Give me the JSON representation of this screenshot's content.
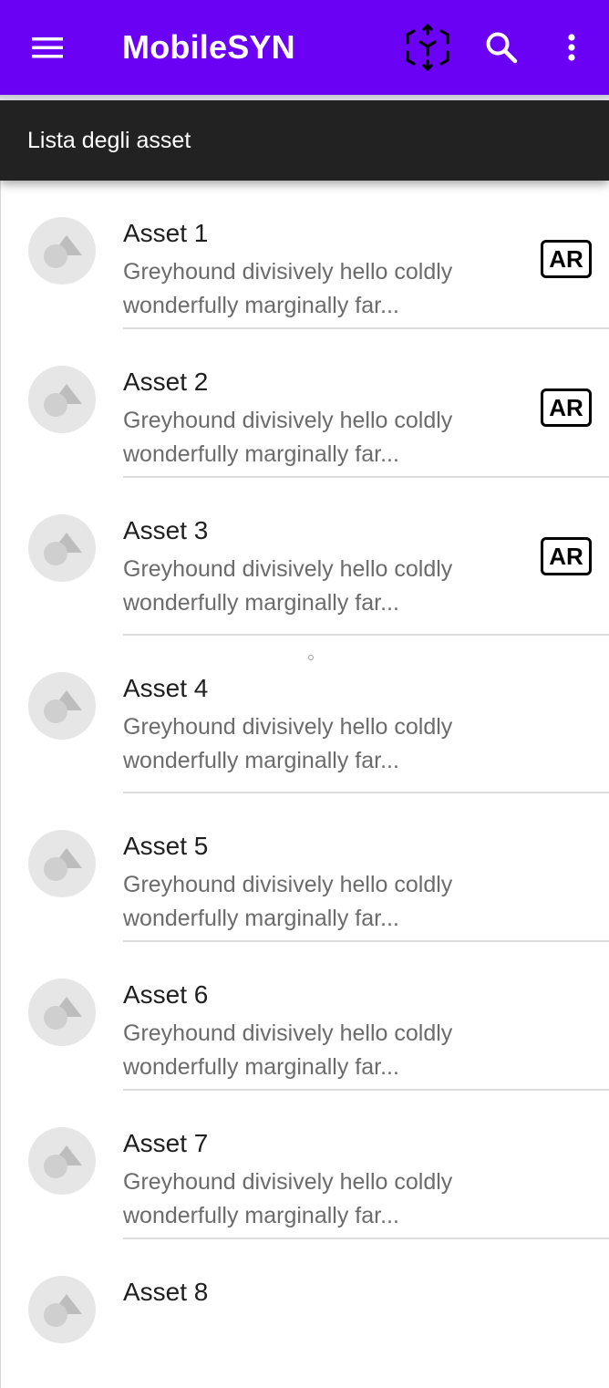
{
  "app": {
    "title": "MobileSYN",
    "colors": {
      "appbar": "#6a00f4",
      "subheader": "#222222"
    },
    "icons": {
      "menu": "menu-icon",
      "ar": "ar-cube-icon",
      "search": "search-icon",
      "more": "more-vert-icon"
    }
  },
  "subheader": {
    "title": "Lista degli asset"
  },
  "assets": [
    {
      "title": "Asset 1",
      "description": "Greyhound divisively hello coldly wonderfully marginally far...",
      "badge": "AR"
    },
    {
      "title": "Asset 2",
      "description": "Greyhound divisively hello coldly wonderfully marginally far...",
      "badge": "AR"
    },
    {
      "title": "Asset 3",
      "description": "Greyhound divisively hello coldly wonderfully marginally far...",
      "badge": "AR"
    },
    {
      "title": "Asset 4",
      "description": "Greyhound divisively hello coldly wonderfully marginally far..."
    },
    {
      "title": "Asset 5",
      "description": "Greyhound divisively hello coldly wonderfully marginally far..."
    },
    {
      "title": "Asset 6",
      "description": "Greyhound divisively hello coldly wonderfully marginally far..."
    },
    {
      "title": "Asset 7",
      "description": "Greyhound divisively hello coldly wonderfully marginally far..."
    },
    {
      "title": "Asset 8"
    }
  ]
}
